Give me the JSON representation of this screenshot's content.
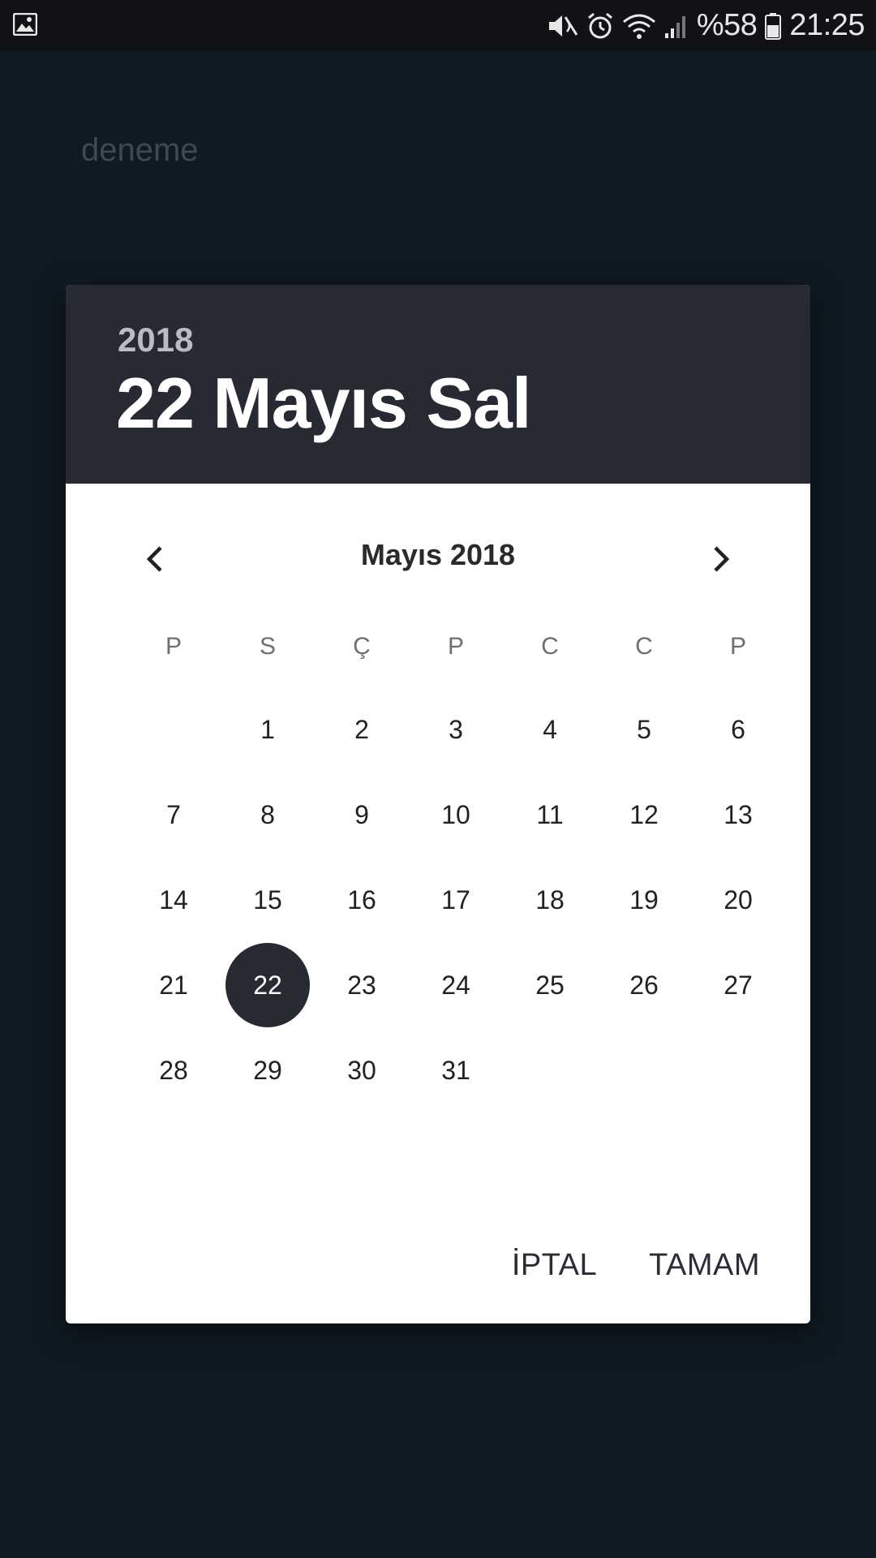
{
  "status_bar": {
    "battery_text": "%58",
    "time": "21:25",
    "icons": [
      "gallery-icon",
      "mute-icon",
      "alarm-icon",
      "wifi-icon",
      "signal-icon",
      "battery-icon"
    ]
  },
  "app": {
    "title": "deneme"
  },
  "dialog": {
    "year": "2018",
    "selected_date": "22 Mayıs Sal",
    "month_title": "Mayıs 2018",
    "weekdays": [
      "P",
      "S",
      "Ç",
      "P",
      "C",
      "C",
      "P"
    ],
    "weeks": [
      [
        "",
        "1",
        "2",
        "3",
        "4",
        "5",
        "6"
      ],
      [
        "7",
        "8",
        "9",
        "10",
        "11",
        "12",
        "13"
      ],
      [
        "14",
        "15",
        "16",
        "17",
        "18",
        "19",
        "20"
      ],
      [
        "21",
        "22",
        "23",
        "24",
        "25",
        "26",
        "27"
      ],
      [
        "28",
        "29",
        "30",
        "31",
        "",
        "",
        ""
      ]
    ],
    "selected_day": "22",
    "cancel_label": "İPTAL",
    "ok_label": "TAMAM",
    "colors": {
      "header_bg": "#272a33",
      "selected_circle": "#272a33",
      "page_bg": "#0f1a22"
    }
  }
}
